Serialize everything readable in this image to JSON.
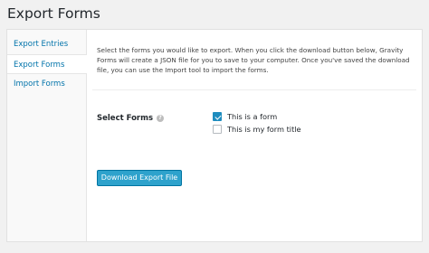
{
  "page": {
    "title": "Export Forms"
  },
  "sidebar": {
    "items": [
      {
        "label": "Export Entries",
        "active": false
      },
      {
        "label": "Export Forms",
        "active": true
      },
      {
        "label": "Import Forms",
        "active": false
      }
    ]
  },
  "main": {
    "description": "Select the forms you would like to export. When you click the download button below, Gravity Forms will create a JSON file for you to save to your computer. Once you've saved the download file, you can use the Import tool to import the forms.",
    "select_forms_label": "Select Forms",
    "help_icon": "question-mark-circle",
    "forms": [
      {
        "label": "This is a form",
        "checked": true
      },
      {
        "label": "This is my form title",
        "checked": false
      }
    ],
    "download_button": "Download Export File"
  },
  "colors": {
    "accent": "#2ea2cc",
    "link": "#0073aa",
    "background": "#f1f1f1"
  }
}
